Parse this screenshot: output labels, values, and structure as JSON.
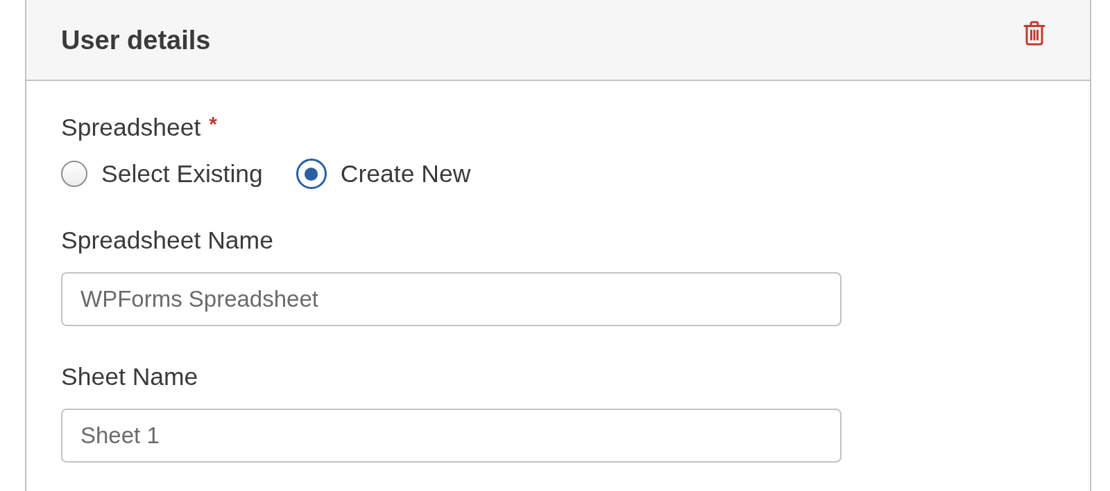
{
  "panel": {
    "title": "User details"
  },
  "spreadsheet": {
    "label": "Spreadsheet",
    "required_mark": "*",
    "options": [
      {
        "label": "Select Existing",
        "selected": false
      },
      {
        "label": "Create New",
        "selected": true
      }
    ]
  },
  "fields": [
    {
      "label": "Spreadsheet Name",
      "placeholder": "WPForms Spreadsheet"
    },
    {
      "label": "Sheet Name",
      "placeholder": "Sheet 1"
    }
  ]
}
